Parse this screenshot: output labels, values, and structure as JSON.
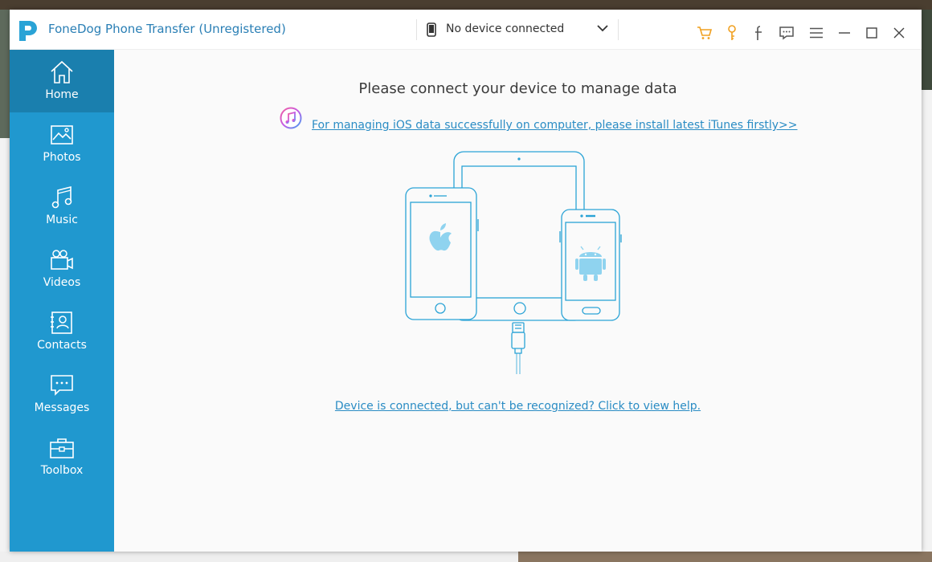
{
  "window": {
    "title": "FoneDog Phone Transfer (Unregistered)"
  },
  "device_selector": {
    "label": "No device connected"
  },
  "toolbar_icons": [
    "cart-icon",
    "key-icon",
    "facebook-icon",
    "feedback-icon",
    "menu-icon",
    "minimize-icon",
    "maximize-icon",
    "close-icon"
  ],
  "sidebar": {
    "items": [
      {
        "label": "Home",
        "icon": "home-icon",
        "active": true
      },
      {
        "label": "Photos",
        "icon": "photos-icon",
        "active": false
      },
      {
        "label": "Music",
        "icon": "music-icon",
        "active": false
      },
      {
        "label": "Videos",
        "icon": "videos-icon",
        "active": false
      },
      {
        "label": "Contacts",
        "icon": "contacts-icon",
        "active": false
      },
      {
        "label": "Messages",
        "icon": "messages-icon",
        "active": false
      },
      {
        "label": "Toolbox",
        "icon": "toolbox-icon",
        "active": false
      }
    ]
  },
  "main": {
    "headline": "Please connect your device to manage data",
    "itunes_link": "For managing iOS data successfully on computer, please install latest iTunes firstly>>",
    "help_link": "Device is connected, but can't be recognized? Click to view help."
  },
  "colors": {
    "sidebar": "#2098cf",
    "sidebar_active": "#1a7fae",
    "link": "#2a8cc4",
    "accent_orange": "#f0a020",
    "illustration": "#2aa3d6"
  }
}
